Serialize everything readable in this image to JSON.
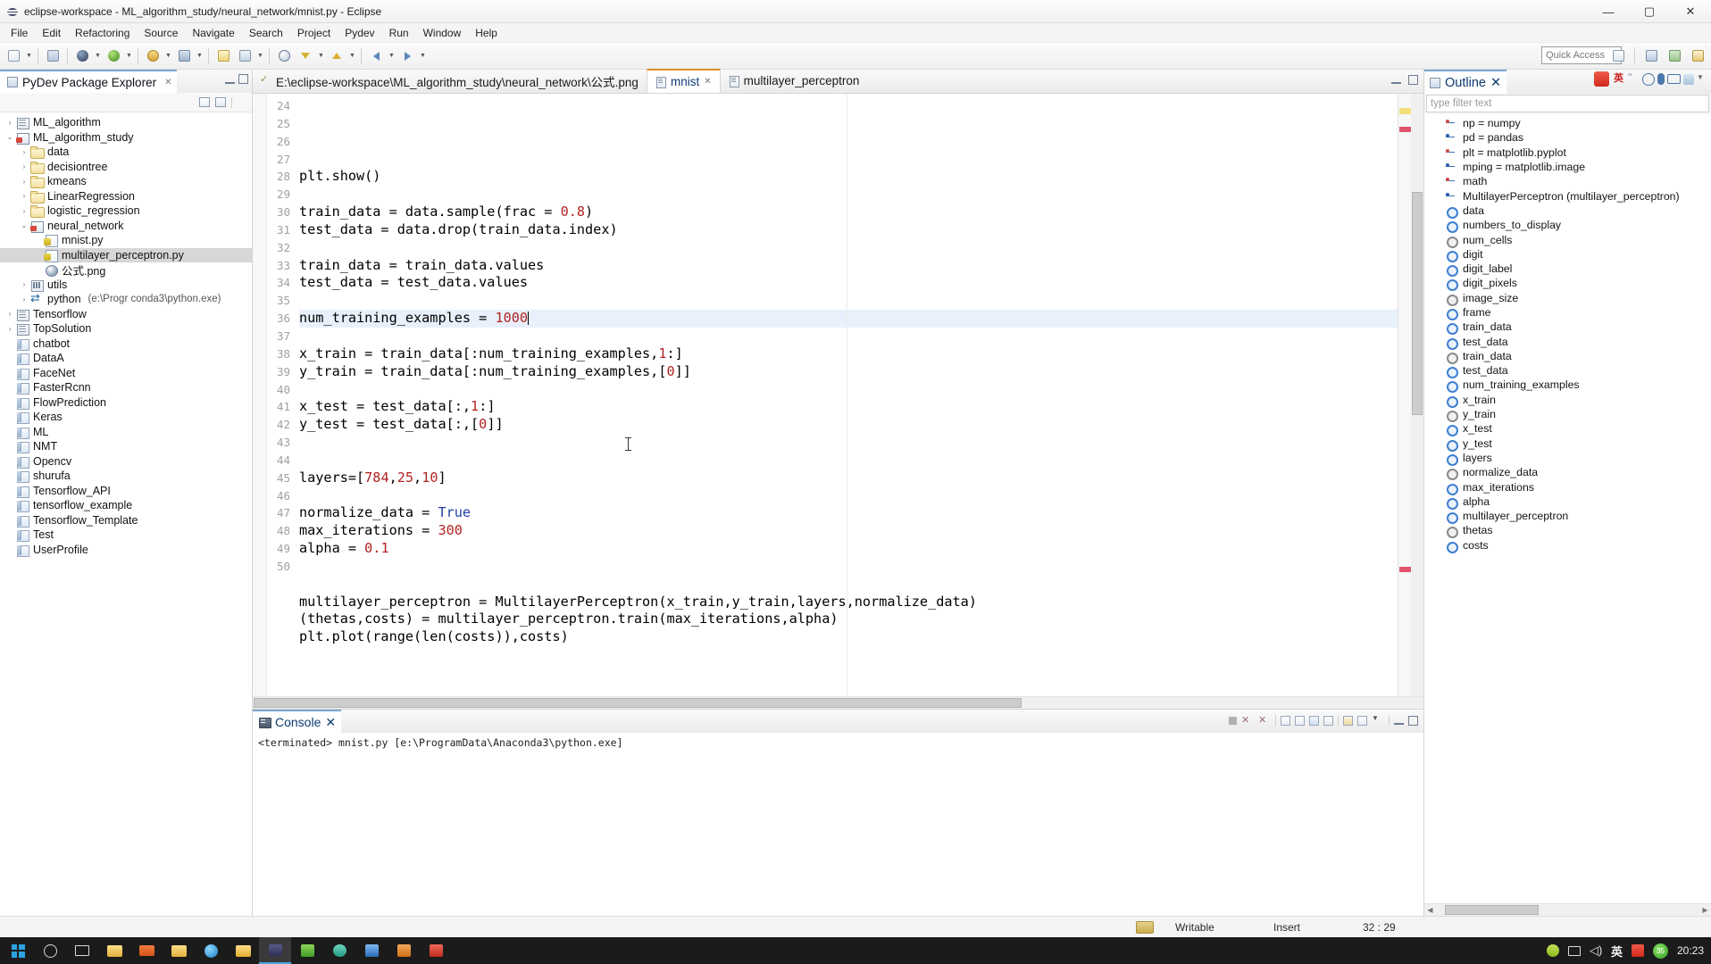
{
  "window": {
    "title": "eclipse-workspace - ML_algorithm_study/neural_network/mnist.py - Eclipse",
    "minimize": "—",
    "maximize": "▢",
    "close": "✕"
  },
  "menu": [
    "File",
    "Edit",
    "Refactoring",
    "Source",
    "Navigate",
    "Search",
    "Project",
    "Pydev",
    "Run",
    "Window",
    "Help"
  ],
  "toolbar": {
    "quick_access_placeholder": "Quick Access"
  },
  "package_explorer": {
    "title": "PyDev Package Explorer",
    "close": "✕",
    "items": [
      {
        "label": "ML_algorithm",
        "indent": 0,
        "icon": "pkg-icon",
        "twist": "collapsed",
        "selected": false
      },
      {
        "label": "ML_algorithm_study",
        "indent": 0,
        "icon": "proj-icon",
        "twist": "expanded",
        "selected": false
      },
      {
        "label": "data",
        "indent": 1,
        "icon": "folder-icon",
        "twist": "collapsed",
        "selected": false
      },
      {
        "label": "decisiontree",
        "indent": 1,
        "icon": "folder-icon",
        "twist": "collapsed",
        "selected": false
      },
      {
        "label": "kmeans",
        "indent": 1,
        "icon": "folder-icon",
        "twist": "collapsed",
        "selected": false
      },
      {
        "label": "LinearRegression",
        "indent": 1,
        "icon": "folder-icon",
        "twist": "collapsed",
        "selected": false
      },
      {
        "label": "logistic_regression",
        "indent": 1,
        "icon": "folder-icon",
        "twist": "collapsed",
        "selected": false
      },
      {
        "label": "neural_network",
        "indent": 1,
        "icon": "py-folder-icon",
        "twist": "expanded",
        "selected": false
      },
      {
        "label": "mnist.py",
        "indent": 2,
        "icon": "python-file-icon",
        "twist": "none",
        "selected": false
      },
      {
        "label": "multilayer_perceptron.py",
        "indent": 2,
        "icon": "python-file-icon",
        "twist": "none",
        "selected": true
      },
      {
        "label": "公式.png",
        "indent": 2,
        "icon": "image-file-icon",
        "twist": "none",
        "selected": false
      },
      {
        "label": "utils",
        "indent": 1,
        "icon": "lib-icon",
        "twist": "collapsed",
        "selected": false
      },
      {
        "label": "python",
        "sub": "(e:\\Progr    conda3\\python.exe)",
        "indent": 1,
        "icon": "interpreter-icon",
        "twist": "collapsed",
        "selected": false
      },
      {
        "label": "Tensorflow",
        "indent": 0,
        "icon": "pkg-icon",
        "twist": "collapsed",
        "selected": false
      },
      {
        "label": "TopSolution",
        "indent": 0,
        "icon": "pkg-icon",
        "twist": "collapsed",
        "selected": false
      },
      {
        "label": "chatbot",
        "indent": 0,
        "icon": "closed-folder-icon",
        "twist": "none",
        "selected": false
      },
      {
        "label": "DataA",
        "indent": 0,
        "icon": "closed-folder-icon",
        "twist": "none",
        "selected": false
      },
      {
        "label": "FaceNet",
        "indent": 0,
        "icon": "closed-folder-icon",
        "twist": "none",
        "selected": false
      },
      {
        "label": "FasterRcnn",
        "indent": 0,
        "icon": "closed-folder-icon",
        "twist": "none",
        "selected": false
      },
      {
        "label": "FlowPrediction",
        "indent": 0,
        "icon": "closed-folder-icon",
        "twist": "none",
        "selected": false
      },
      {
        "label": "Keras",
        "indent": 0,
        "icon": "closed-folder-icon",
        "twist": "none",
        "selected": false
      },
      {
        "label": "ML",
        "indent": 0,
        "icon": "closed-folder-icon",
        "twist": "none",
        "selected": false
      },
      {
        "label": "NMT",
        "indent": 0,
        "icon": "closed-folder-icon",
        "twist": "none",
        "selected": false
      },
      {
        "label": "Opencv",
        "indent": 0,
        "icon": "closed-folder-icon",
        "twist": "none",
        "selected": false
      },
      {
        "label": "shurufa",
        "indent": 0,
        "icon": "closed-folder-icon",
        "twist": "none",
        "selected": false
      },
      {
        "label": "Tensorflow_API",
        "indent": 0,
        "icon": "closed-folder-icon",
        "twist": "none",
        "selected": false
      },
      {
        "label": "tensorflow_example",
        "indent": 0,
        "icon": "closed-folder-icon",
        "twist": "none",
        "selected": false
      },
      {
        "label": "Tensorflow_Template",
        "indent": 0,
        "icon": "closed-folder-icon",
        "twist": "none",
        "selected": false
      },
      {
        "label": "Test",
        "indent": 0,
        "icon": "closed-folder-icon",
        "twist": "none",
        "selected": false
      },
      {
        "label": "UserProfile",
        "indent": 0,
        "icon": "closed-folder-icon",
        "twist": "none",
        "selected": false
      }
    ]
  },
  "editor": {
    "tabs": [
      {
        "label": "E:\\eclipse-workspace\\ML_algorithm_study\\neural_network\\公式.png",
        "active": false,
        "icon": "check-icon",
        "closable": false
      },
      {
        "label": "mnist",
        "active": true,
        "icon": "file-icon",
        "closable": true,
        "close": "✕"
      },
      {
        "label": "multilayer_perceptron",
        "active": false,
        "icon": "file-icon",
        "closable": false
      }
    ],
    "first_line_number": 24,
    "lines": [
      {
        "n": 24,
        "tokens": [
          {
            "t": "plt.show()",
            "c": "plain"
          }
        ]
      },
      {
        "n": 25,
        "tokens": []
      },
      {
        "n": 26,
        "tokens": [
          {
            "t": "train_data = data.sample(frac = ",
            "c": "plain"
          },
          {
            "t": "0.8",
            "c": "num"
          },
          {
            "t": ")",
            "c": "plain"
          }
        ]
      },
      {
        "n": 27,
        "tokens": [
          {
            "t": "test_data = data.drop(train_data.index)",
            "c": "plain"
          }
        ]
      },
      {
        "n": 28,
        "tokens": []
      },
      {
        "n": 29,
        "tokens": [
          {
            "t": "train_data = train_data.values",
            "c": "plain"
          }
        ]
      },
      {
        "n": 30,
        "tokens": [
          {
            "t": "test_data = test_data.values",
            "c": "plain"
          }
        ]
      },
      {
        "n": 31,
        "tokens": []
      },
      {
        "n": 32,
        "highlight": true,
        "caret": true,
        "tokens": [
          {
            "t": "num_training_examples = ",
            "c": "plain"
          },
          {
            "t": "1000",
            "c": "num"
          }
        ]
      },
      {
        "n": 33,
        "tokens": []
      },
      {
        "n": 34,
        "tokens": [
          {
            "t": "x_train = train_data[:num_training_examples,",
            "c": "plain"
          },
          {
            "t": "1",
            "c": "num"
          },
          {
            "t": ":]",
            "c": "plain"
          }
        ]
      },
      {
        "n": 35,
        "tokens": [
          {
            "t": "y_train = train_data[:num_training_examples,[",
            "c": "plain"
          },
          {
            "t": "0",
            "c": "num"
          },
          {
            "t": "]]",
            "c": "plain"
          }
        ]
      },
      {
        "n": 36,
        "tokens": []
      },
      {
        "n": 37,
        "tokens": [
          {
            "t": "x_test = test_data[:,",
            "c": "plain"
          },
          {
            "t": "1",
            "c": "num"
          },
          {
            "t": ":]",
            "c": "plain"
          }
        ]
      },
      {
        "n": 38,
        "tokens": [
          {
            "t": "y_test = test_data[:,[",
            "c": "plain"
          },
          {
            "t": "0",
            "c": "num"
          },
          {
            "t": "]]",
            "c": "plain"
          }
        ]
      },
      {
        "n": 39,
        "tokens": []
      },
      {
        "n": 40,
        "tokens": []
      },
      {
        "n": 41,
        "tokens": [
          {
            "t": "layers=[",
            "c": "plain"
          },
          {
            "t": "784",
            "c": "num"
          },
          {
            "t": ",",
            "c": "plain"
          },
          {
            "t": "25",
            "c": "num"
          },
          {
            "t": ",",
            "c": "plain"
          },
          {
            "t": "10",
            "c": "num"
          },
          {
            "t": "]",
            "c": "plain"
          }
        ]
      },
      {
        "n": 42,
        "tokens": []
      },
      {
        "n": 43,
        "tokens": [
          {
            "t": "normalize_data = ",
            "c": "plain"
          },
          {
            "t": "True",
            "c": "bi"
          }
        ]
      },
      {
        "n": 44,
        "tokens": [
          {
            "t": "max_iterations = ",
            "c": "plain"
          },
          {
            "t": "300",
            "c": "num"
          }
        ]
      },
      {
        "n": 45,
        "tokens": [
          {
            "t": "alpha = ",
            "c": "plain"
          },
          {
            "t": "0.1",
            "c": "num"
          }
        ]
      },
      {
        "n": 46,
        "tokens": []
      },
      {
        "n": 47,
        "tokens": []
      },
      {
        "n": 48,
        "tokens": [
          {
            "t": "multilayer_perceptron = MultilayerPerceptron(x_train,y_train,layers,normalize_data)",
            "c": "plain"
          }
        ]
      },
      {
        "n": 49,
        "tokens": [
          {
            "t": "(thetas,costs) = multilayer_perceptron.train(max_iterations,alpha)",
            "c": "plain"
          }
        ]
      },
      {
        "n": 50,
        "tokens": [
          {
            "t": "plt.plot(range(len(costs)),costs)",
            "c": "plain"
          }
        ]
      }
    ]
  },
  "console": {
    "title": "Console",
    "close": "✕",
    "output": "<terminated> mnist.py [e:\\ProgramData\\Anaconda3\\python.exe]"
  },
  "outline": {
    "title": "Outline",
    "close": "✕",
    "filter_placeholder": "type filter text",
    "items": [
      {
        "label": "np = numpy",
        "icon": "import-icon",
        "kind": "import-red"
      },
      {
        "label": "pd = pandas",
        "icon": "import-icon",
        "kind": "import-blue"
      },
      {
        "label": "plt = matplotlib.pyplot",
        "icon": "import-icon",
        "kind": "import-red"
      },
      {
        "label": "mping = matplotlib.image",
        "icon": "import-icon",
        "kind": "import-blue"
      },
      {
        "label": "math",
        "icon": "import-icon",
        "kind": "import-red"
      },
      {
        "label": "MultilayerPerceptron (multilayer_perceptron)",
        "icon": "import-icon",
        "kind": "import-blue"
      },
      {
        "label": "data",
        "icon": "variable-icon",
        "kind": "var"
      },
      {
        "label": "numbers_to_display",
        "icon": "variable-icon",
        "kind": "var"
      },
      {
        "label": "num_cells",
        "icon": "variable-icon",
        "kind": "var-grey"
      },
      {
        "label": "digit",
        "icon": "variable-icon",
        "kind": "var"
      },
      {
        "label": "digit_label",
        "icon": "variable-icon",
        "kind": "var"
      },
      {
        "label": "digit_pixels",
        "icon": "variable-icon",
        "kind": "var"
      },
      {
        "label": "image_size",
        "icon": "variable-icon",
        "kind": "var-grey"
      },
      {
        "label": "frame",
        "icon": "variable-icon",
        "kind": "var"
      },
      {
        "label": "train_data",
        "icon": "variable-icon",
        "kind": "var"
      },
      {
        "label": "test_data",
        "icon": "variable-icon",
        "kind": "var"
      },
      {
        "label": "train_data",
        "icon": "variable-icon",
        "kind": "var-grey"
      },
      {
        "label": "test_data",
        "icon": "variable-icon",
        "kind": "var"
      },
      {
        "label": "num_training_examples",
        "icon": "variable-icon",
        "kind": "var"
      },
      {
        "label": "x_train",
        "icon": "variable-icon",
        "kind": "var"
      },
      {
        "label": "y_train",
        "icon": "variable-icon",
        "kind": "var-grey"
      },
      {
        "label": "x_test",
        "icon": "variable-icon",
        "kind": "var"
      },
      {
        "label": "y_test",
        "icon": "variable-icon",
        "kind": "var"
      },
      {
        "label": "layers",
        "icon": "variable-icon",
        "kind": "var"
      },
      {
        "label": "normalize_data",
        "icon": "variable-icon",
        "kind": "var-grey"
      },
      {
        "label": "max_iterations",
        "icon": "variable-icon",
        "kind": "var"
      },
      {
        "label": "alpha",
        "icon": "variable-icon",
        "kind": "var"
      },
      {
        "label": "multilayer_perceptron",
        "icon": "variable-icon",
        "kind": "var"
      },
      {
        "label": "thetas",
        "icon": "variable-icon",
        "kind": "var-grey"
      },
      {
        "label": "costs",
        "icon": "variable-icon",
        "kind": "var"
      }
    ]
  },
  "status": {
    "writable": "Writable",
    "insert_mode": "Insert",
    "cursor_position": "32 : 29"
  },
  "taskbar": {
    "clock": "20:23",
    "ime": "英",
    "battery": "35"
  },
  "colors": {
    "accent": "#7aa6d4",
    "active_tab_top": "#e08b2a",
    "number_literal": "#b22222",
    "builtin": "#1f3ea8",
    "selection": "#d7d7d7",
    "line_highlight": "#e8f0fb"
  }
}
